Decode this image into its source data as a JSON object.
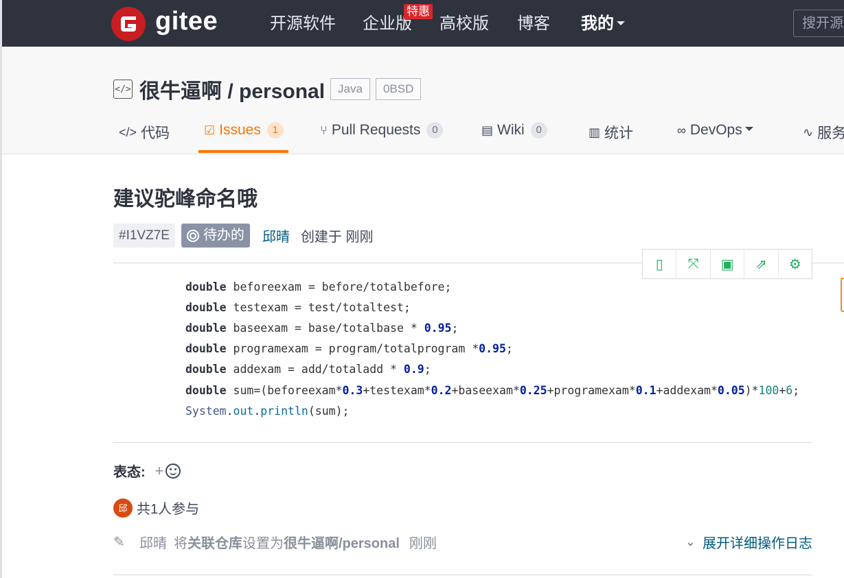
{
  "nav": {
    "brand": "gitee",
    "items": [
      "开源软件",
      "企业版",
      "高校版",
      "博客",
      "我的"
    ],
    "special_badge": "特惠",
    "search_placeholder": "搜开源"
  },
  "repo": {
    "owner_and_name": "很牛逼啊 / personal",
    "tags": [
      "Java",
      "0BSD"
    ]
  },
  "tabs": [
    {
      "label": "代码",
      "icon": "code-icon"
    },
    {
      "label": "Issues",
      "count": "1",
      "icon": "issues-icon",
      "active": true
    },
    {
      "label": "Pull Requests",
      "count": "0",
      "icon": "pull-request-icon"
    },
    {
      "label": "Wiki",
      "count": "0",
      "icon": "wiki-book-icon"
    },
    {
      "label": "统计",
      "icon": "bar-chart-icon"
    },
    {
      "label": "DevOps",
      "icon": "infinity-icon"
    },
    {
      "label": "服务",
      "icon": "pulse-icon"
    }
  ],
  "issue": {
    "title": "建议驼峰命名哦",
    "id": "#I1VZ7E",
    "state": "待办的",
    "author": "邱晴",
    "created": "创建于 刚刚"
  },
  "code_lines": [
    "double beforeexam = before/totalbefore;",
    "double testexam = test/totaltest;",
    "double baseexam = base/totalbase * 0.95;",
    "double programexam = program/totalprogram *0.95;",
    "double addexam = add/totaladd * 0.9;",
    "double sum=(beforeexam*0.3+testexam*0.2+baseexam*0.25+programexam*0.1+addexam*0.05)*100+6;",
    "System.out.println(sum);"
  ],
  "toolbar_icons": [
    "mobile-preview-icon",
    "fullscreen-icon",
    "save-icon",
    "share-icon",
    "settings-icon"
  ],
  "reactions": {
    "label": "表态:",
    "plus": "+"
  },
  "participants": {
    "avatar_text": "邱",
    "text": "共1人参与"
  },
  "activity": {
    "actor": "邱晴",
    "action_prefix": "将",
    "field": "关联仓库",
    "action_mid": "设置为",
    "target": "很牛逼啊/personal",
    "time": "刚刚",
    "expand_label": "展开详细操作日志"
  },
  "colors": {
    "nav_bg": "#2e333e",
    "brand_red": "#c71d23",
    "active_orange": "#fe7300",
    "link_blue": "#005980",
    "toolbar_green": "#1fb25e"
  }
}
